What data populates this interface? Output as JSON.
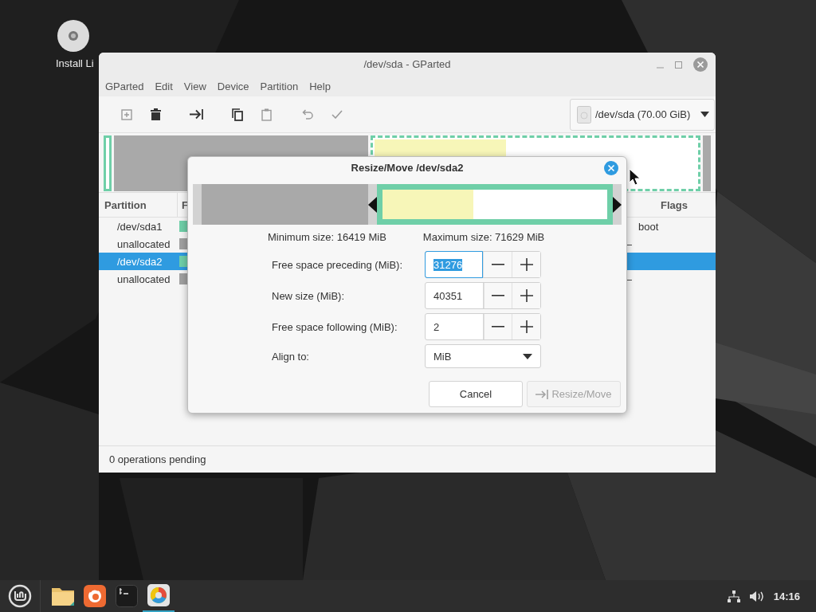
{
  "desktop_icons": [
    {
      "label": "Install Li"
    }
  ],
  "window": {
    "title": "/dev/sda - GParted",
    "menu": [
      "GParted",
      "Edit",
      "View",
      "Device",
      "Partition",
      "Help"
    ],
    "toolbar": [
      {
        "kind": "new",
        "disabled": true
      },
      {
        "kind": "delete",
        "disabled": false
      },
      {
        "kind": "resize",
        "disabled": false
      },
      {
        "kind": "copy",
        "disabled": false
      },
      {
        "kind": "paste",
        "disabled": true
      },
      {
        "kind": "undo",
        "disabled": true
      },
      {
        "kind": "apply",
        "disabled": true
      }
    ],
    "device": "/dev/sda (70.00 GiB)",
    "partition_map": [
      {
        "kind": "partition",
        "selected": false
      },
      {
        "kind": "unallocated",
        "selected": false
      },
      {
        "kind": "partition",
        "selected": true,
        "level": 0.41
      },
      {
        "kind": "unallocated",
        "selected": false
      }
    ],
    "table": {
      "columns": [
        "Partition",
        "F",
        "Flags"
      ],
      "rows": [
        {
          "partition": "/dev/sda1",
          "color": "#6fcfa8",
          "flags": "boot",
          "selected": false
        },
        {
          "partition": "unallocated",
          "color": "#a0a0a0",
          "column_3": "–",
          "selected": false
        },
        {
          "partition": "/dev/sda2",
          "color": "#6fcfa8",
          "selected": true
        },
        {
          "partition": "unallocated",
          "color": "#a0a0a0",
          "column_3": "–",
          "selected": false
        }
      ]
    },
    "status_bar": "0 operations pending"
  },
  "dialog": {
    "title": "Resize/Move /dev/sda2",
    "graphic": {
      "level": 0.41
    },
    "minimum": "Minimum size: 16419 MiB",
    "maximum": "Maximum size: 71629 MiB",
    "fields": [
      {
        "label": "Free space preceding (MiB):",
        "value": "31276",
        "focused": true
      },
      {
        "label": "New size (MiB):",
        "value": "40351",
        "focused": false
      },
      {
        "label": "Free space following (MiB):",
        "value": "2",
        "focused": false
      }
    ],
    "align": {
      "label": "Align to:",
      "value": "MiB"
    },
    "buttons": [
      {
        "label": "Cancel",
        "kind": "cancel",
        "disabled": false
      },
      {
        "label": "Resize/Move",
        "kind": "resize",
        "disabled": true
      }
    ]
  },
  "taskbar": {
    "apps": [
      {
        "kind": "folder",
        "active": false
      },
      {
        "kind": "browser",
        "active": false
      },
      {
        "kind": "terminal",
        "active": false
      },
      {
        "kind": "disk",
        "active": true
      }
    ],
    "clock": "14:16"
  }
}
